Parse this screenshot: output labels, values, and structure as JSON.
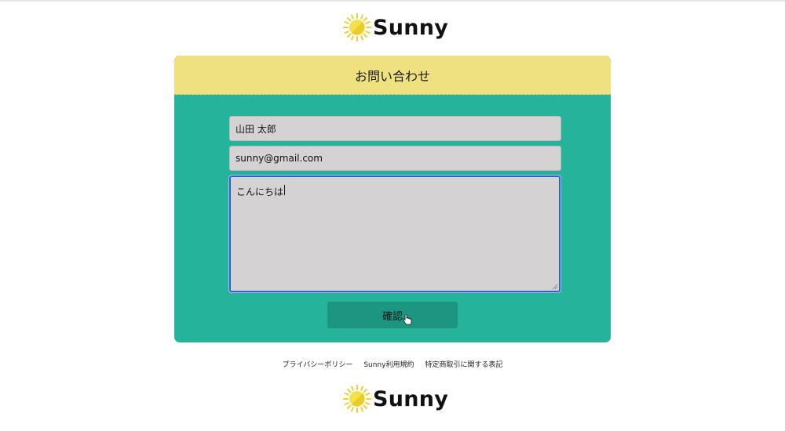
{
  "brand": {
    "name": "Sunny",
    "logo_icon": "sun-icon",
    "sun_color": "#f5e04a",
    "ray_color": "#e6cf3a"
  },
  "form": {
    "title": "お問い合わせ",
    "name_value": "山田 太郎",
    "email_value": "sunny@gmail.com",
    "message_value": "こんにちは",
    "confirm_label": "確認"
  },
  "colors": {
    "header_bg": "#efe180",
    "card_bg": "#25b39b",
    "button_bg": "#1c9680",
    "field_bg": "#d4d2d3"
  },
  "footer": {
    "links": [
      "プライバシーポリシー",
      "Sunny利用規約",
      "特定商取引に関する表記"
    ]
  }
}
